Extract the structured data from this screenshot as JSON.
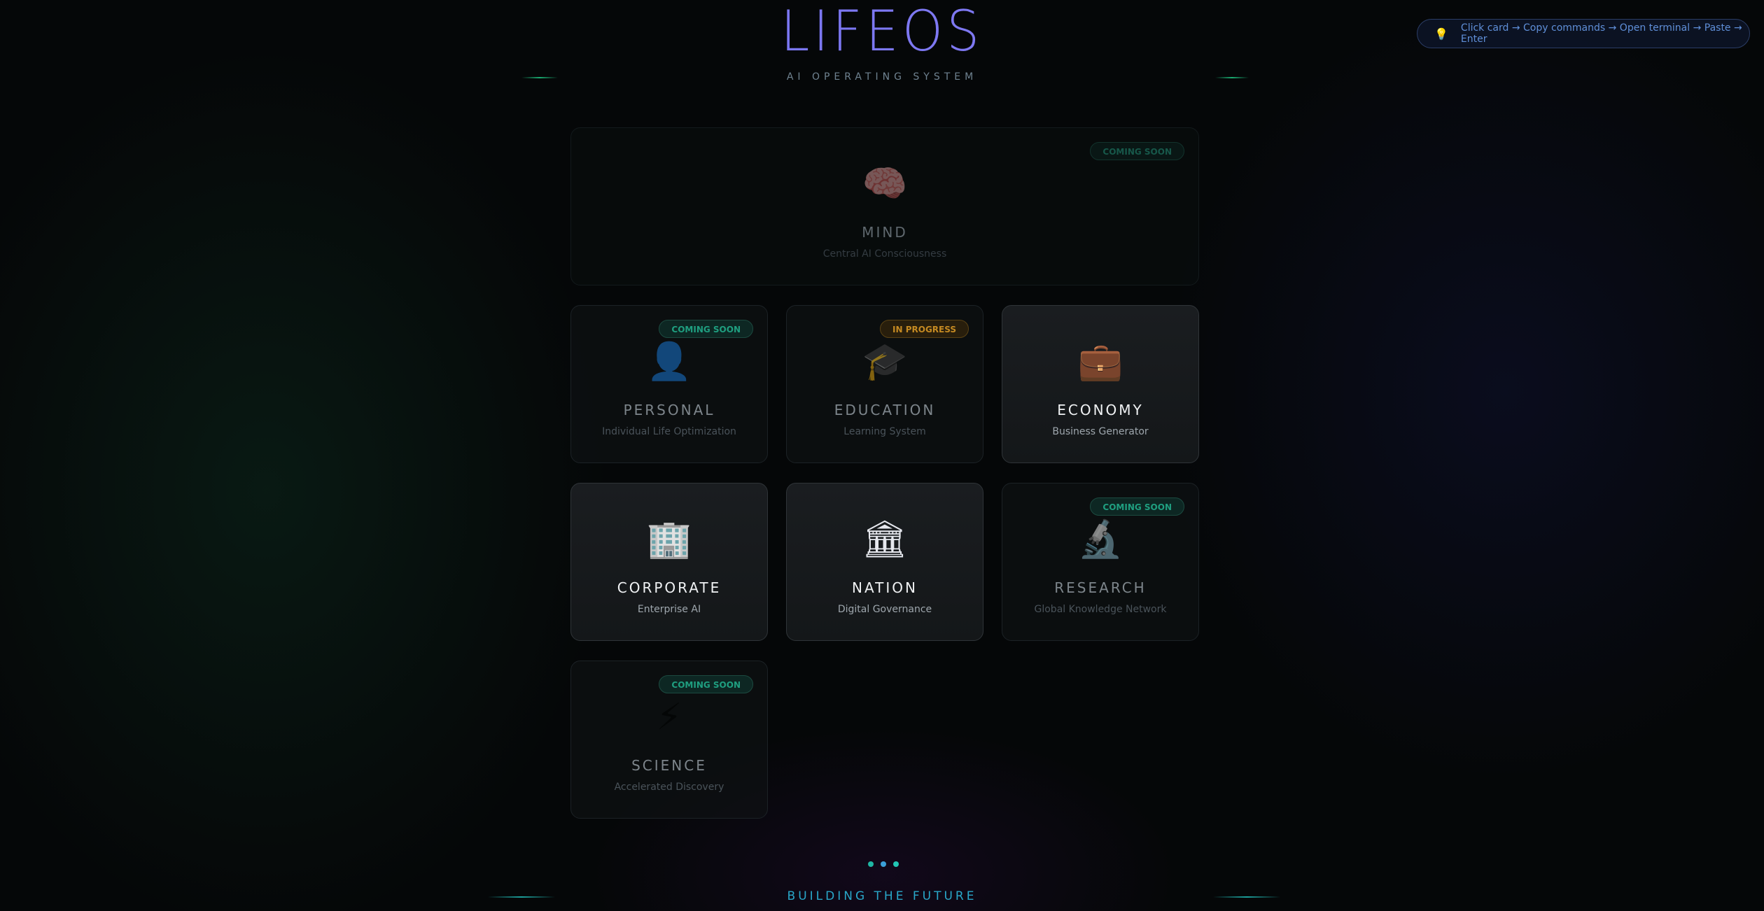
{
  "header": {
    "title": "LIFEOS",
    "subtitle": "AI OPERATING SYSTEM"
  },
  "hint": {
    "icon": "lightbulb-icon",
    "text": "Click card → Copy commands → Open terminal → Paste → Enter"
  },
  "cards": {
    "mind": {
      "icon": "🧠",
      "icon_name": "brain-icon",
      "name": "MIND",
      "desc": "Central AI Consciousness",
      "badge": "COMING SOON"
    },
    "personal": {
      "icon": "👤",
      "icon_name": "person-icon",
      "name": "PERSONAL",
      "desc": "Individual Life Optimization",
      "badge": "COMING SOON"
    },
    "education": {
      "icon": "🎓",
      "icon_name": "graduation-cap-icon",
      "name": "EDUCATION",
      "desc": "Learning System",
      "badge": "IN PROGRESS"
    },
    "economy": {
      "icon": "💼",
      "icon_name": "briefcase-icon",
      "name": "ECONOMY",
      "desc": "Business Generator"
    },
    "corporate": {
      "icon": "🏢",
      "icon_name": "office-building-icon",
      "name": "CORPORATE",
      "desc": "Enterprise AI"
    },
    "nation": {
      "icon": "🏛",
      "icon_name": "government-building-icon",
      "name": "NATION",
      "desc": "Digital Governance"
    },
    "research": {
      "icon": "🔬",
      "icon_name": "microscope-icon",
      "name": "RESEARCH",
      "desc": "Global Knowledge Network",
      "badge": "COMING SOON"
    },
    "science": {
      "icon": "⚡",
      "icon_name": "lightning-icon",
      "name": "SCIENCE",
      "desc": "Accelerated Discovery",
      "badge": "COMING SOON"
    }
  },
  "footer": {
    "tagline": "BUILDING THE FUTURE"
  },
  "colors": {
    "title_accent": "#6f73f4",
    "coming_soon": "#1f9f80",
    "in_progress": "#c58a22",
    "footer_accent": "#29a7c9"
  }
}
